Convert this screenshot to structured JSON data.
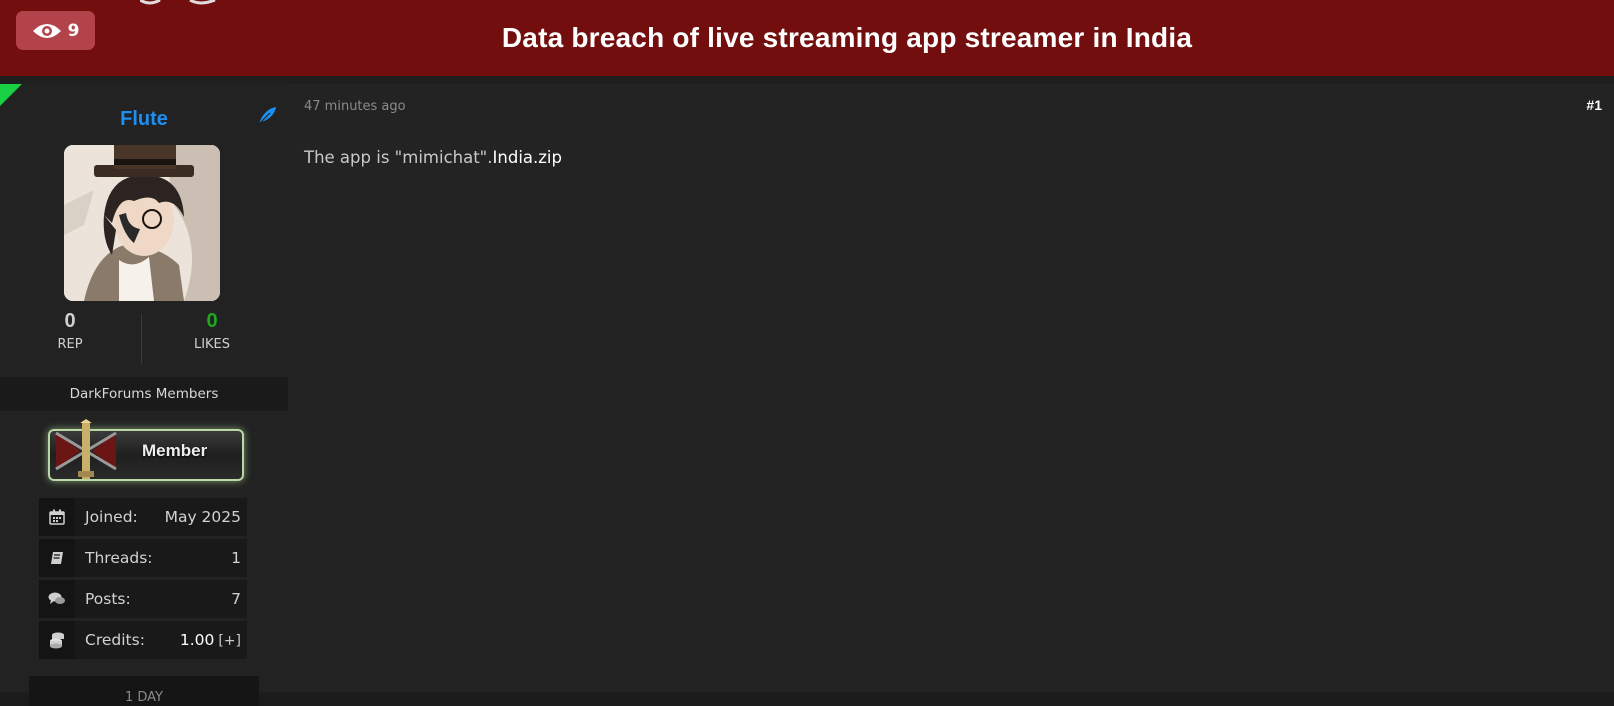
{
  "header": {
    "views_count": "9",
    "title": "Data breach of live streaming app streamer in India"
  },
  "author": {
    "username": "Flute",
    "rep_value": "0",
    "rep_label": "REP",
    "likes_value": "0",
    "likes_label": "LIKES",
    "usergroup": "DarkForums Members",
    "rank_label": "Member",
    "info": [
      {
        "icon": "calendar-icon",
        "label": "Joined:",
        "value": "May 2025"
      },
      {
        "icon": "book-icon",
        "label": "Threads:",
        "value": "1"
      },
      {
        "icon": "comments-icon",
        "label": "Posts:",
        "value": "7"
      },
      {
        "icon": "coins-icon",
        "label": "Credits:",
        "value": "1.00",
        "extra": "[+]"
      }
    ],
    "bottom_tab": "1 DAY"
  },
  "post": {
    "time": "47 minutes ago",
    "number": "#1",
    "text": "The app is \"mimichat\".",
    "attachment": "India.zip"
  },
  "colors": {
    "header_bg": "#720e0e",
    "badge_bg": "#b2434a",
    "username": "#1d8ef2",
    "likes": "#1fa71f",
    "online": "#19cf44"
  }
}
